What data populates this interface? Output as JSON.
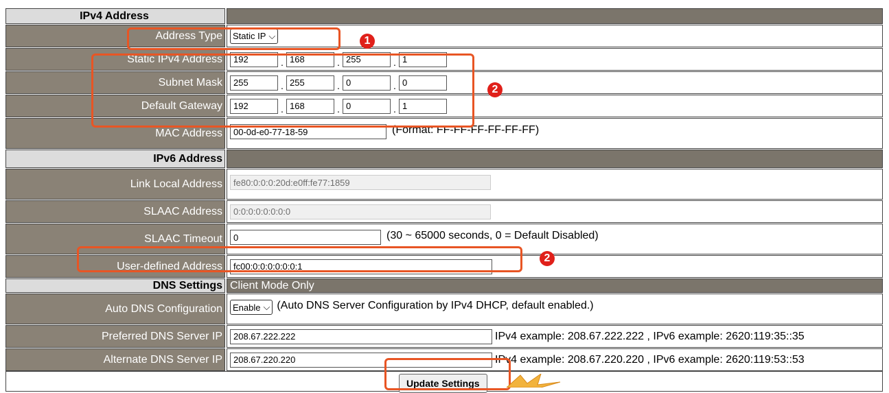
{
  "ipv4": {
    "header": "IPv4 Address",
    "address_type_label": "Address Type",
    "address_type_value": "Static IP",
    "static_label": "Static IPv4 Address",
    "static": [
      "192",
      "168",
      "255",
      "1"
    ],
    "mask_label": "Subnet Mask",
    "mask": [
      "255",
      "255",
      "0",
      "0"
    ],
    "gateway_label": "Default Gateway",
    "gateway": [
      "192",
      "168",
      "0",
      "1"
    ],
    "mac_label": "MAC Address",
    "mac_value": "00-0d-e0-77-18-59",
    "mac_hint": "(Format: FF-FF-FF-FF-FF-FF)"
  },
  "ipv6": {
    "header": "IPv6 Address",
    "link_local_label": "Link Local Address",
    "link_local_value": "fe80:0:0:0:20d:e0ff:fe77:1859",
    "slaac_label": "SLAAC Address",
    "slaac_value": "0:0:0:0:0:0:0:0",
    "slaac_timeout_label": "SLAAC Timeout",
    "slaac_timeout_value": "0",
    "slaac_timeout_hint": "(30 ~ 65000 seconds, 0 = Default Disabled)",
    "user_defined_label": "User-defined Address",
    "user_defined_value": "fc00:0:0:0:0:0:0:1"
  },
  "dns": {
    "header": "DNS Settings",
    "header_note": "Client Mode Only",
    "auto_label": "Auto DNS Configuration",
    "auto_value": "Enable",
    "auto_hint": "(Auto DNS Server Configuration by IPv4 DHCP, default enabled.)",
    "preferred_label": "Preferred DNS Server IP",
    "preferred_value": "208.67.222.222",
    "preferred_hint": "IPv4 example: 208.67.222.222 , IPv6 example: 2620:119:35::35",
    "alternate_label": "Alternate DNS Server IP",
    "alternate_value": "208.67.220.220",
    "alternate_hint": "IPv4 example: 208.67.220.220 , IPv6 example: 2620:119:53::53"
  },
  "update_button": "Update Settings",
  "badges": {
    "one": "1",
    "two": "2"
  },
  "colors": {
    "label_bg": "#8a8276",
    "section_bg": "#7b756b",
    "highlight": "#e85524",
    "badge": "#e0201a"
  }
}
